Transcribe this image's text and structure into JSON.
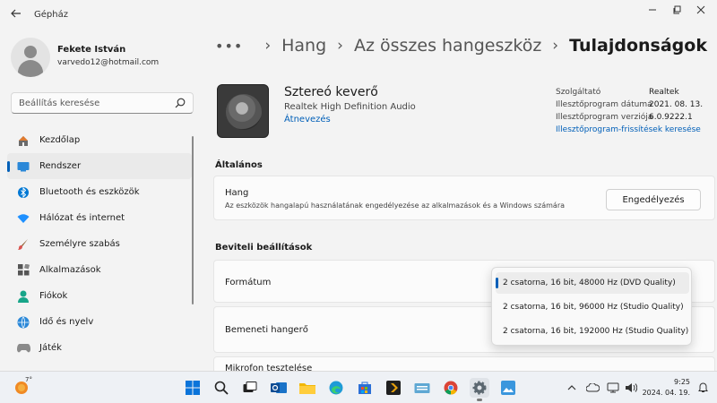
{
  "window": {
    "app_title": "Gépház",
    "back_icon": "arrow-left-icon",
    "minimize_icon": "minimize-icon",
    "maximize_icon": "maximize-icon",
    "close_icon": "close-icon"
  },
  "user": {
    "name": "Fekete István",
    "email": "varvedo12@hotmail.com"
  },
  "search": {
    "placeholder": "Beállítás keresése"
  },
  "sidebar": {
    "items": [
      {
        "label": "Kezdőlap",
        "icon": "home-icon",
        "active": false
      },
      {
        "label": "Rendszer",
        "icon": "system-icon",
        "active": true
      },
      {
        "label": "Bluetooth és eszközök",
        "icon": "bluetooth-icon",
        "active": false
      },
      {
        "label": "Hálózat és internet",
        "icon": "network-icon",
        "active": false
      },
      {
        "label": "Személyre szabás",
        "icon": "brush-icon",
        "active": false
      },
      {
        "label": "Alkalmazások",
        "icon": "apps-icon",
        "active": false
      },
      {
        "label": "Fiókok",
        "icon": "accounts-icon",
        "active": false
      },
      {
        "label": "Idő és nyelv",
        "icon": "time-language-icon",
        "active": false
      },
      {
        "label": "Játék",
        "icon": "gaming-icon",
        "active": false
      }
    ]
  },
  "breadcrumb": {
    "items": [
      "Hang",
      "Az összes hangeszköz"
    ],
    "current": "Tulajdonságok"
  },
  "device": {
    "name": "Sztereó keverő",
    "driver": "Realtek High Definition Audio",
    "rename_label": "Átnevezés"
  },
  "driver_info": {
    "provider_label": "Szolgáltató",
    "provider_value": "Realtek",
    "date_label": "Illesztőprogram dátuma",
    "date_value": "2021. 08. 13.",
    "version_label": "Illesztőprogram verziója",
    "version_value": "6.0.9222.1",
    "update_link": "Illesztőprogram-frissítések keresése"
  },
  "general": {
    "title": "Általános",
    "audio_label": "Hang",
    "audio_desc": "Az eszközök hangalapú használatának engedélyezése az alkalmazások és a Windows számára",
    "allow_button": "Engedélyezés"
  },
  "input_settings": {
    "title": "Beviteli beállítások",
    "format_label": "Formátum",
    "volume_label": "Bemeneti hangerő",
    "test_label": "Mikrofon tesztelése",
    "format_options": [
      "2 csatorna, 16 bit, 48000 Hz (DVD Quality)",
      "2 csatorna, 16 bit, 96000 Hz (Studio Quality)",
      "2 csatorna, 16 bit, 192000 Hz (Studio Quality)"
    ],
    "selected_index": 0
  },
  "taskbar": {
    "weather_temp": "7°",
    "time": "9:25",
    "date": "2024. 04. 19.",
    "accent": "#005fb8"
  }
}
